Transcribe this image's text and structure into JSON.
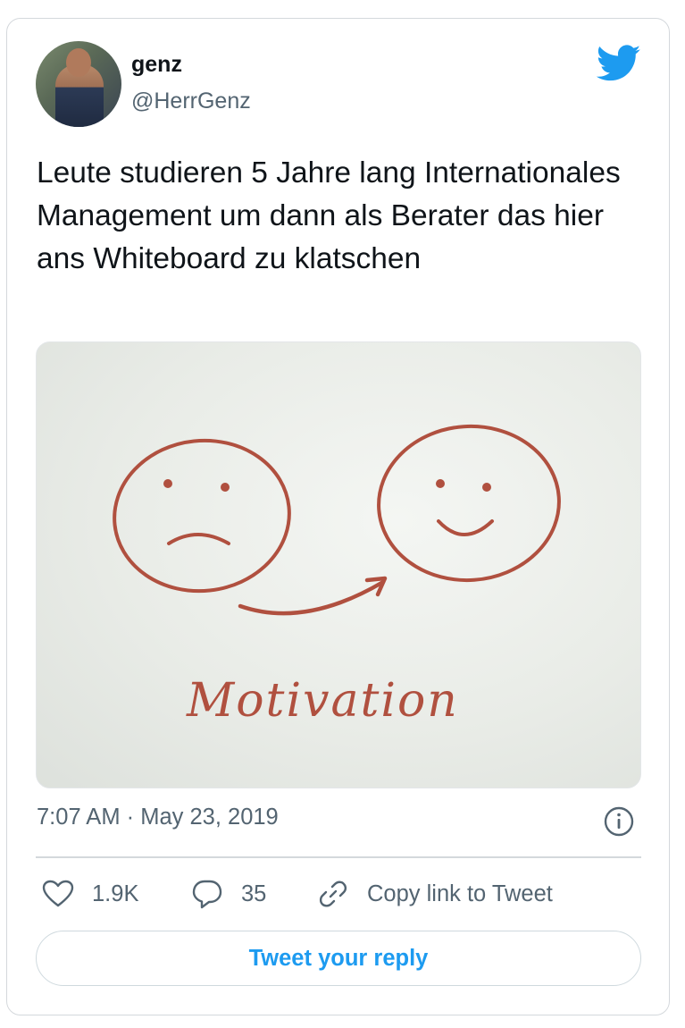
{
  "author": {
    "name": "genz",
    "handle": "@HerrGenz",
    "avatar_icon": "profile-photo"
  },
  "brand": {
    "logo_icon": "twitter-bird-icon",
    "accent_color": "#1d9bf0"
  },
  "tweet": {
    "text": "Leute studieren 5 Jahre lang Internationales Management um dann als Berater das hier ans Whiteboard zu klatschen",
    "media": {
      "description_icon": "whiteboard-photo",
      "handwritten_label": "Motivation",
      "marker_color": "#b0503f"
    },
    "timestamp": "7:07 AM · May 23, 2019"
  },
  "actions": {
    "likes": {
      "icon": "heart-icon",
      "count": "1.9K"
    },
    "replies": {
      "icon": "speech-bubble-icon",
      "count": "35"
    },
    "copy_link": {
      "icon": "link-icon",
      "label": "Copy link to Tweet"
    }
  },
  "reply_button": {
    "label": "Tweet your reply"
  }
}
